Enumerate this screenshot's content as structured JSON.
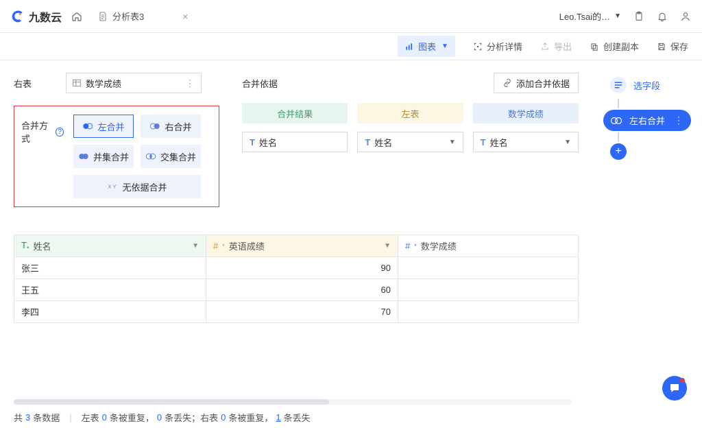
{
  "header": {
    "brand": "九数云",
    "tab_label": "分析表3",
    "user_label": "Leo.Tsai的…"
  },
  "toolbar": {
    "chart": "图表",
    "detail": "分析详情",
    "export": "导出",
    "duplicate": "创建副本",
    "save": "保存"
  },
  "config": {
    "right_table_label": "右表",
    "right_table_value": "数学成绩",
    "merge_mode_label": "合并方式",
    "merge_buttons": {
      "left": "左合并",
      "right": "右合并",
      "union": "并集合并",
      "intersect": "交集合并",
      "nobasis": "无依据合并"
    },
    "basis_label": "合并依据",
    "add_basis": "添加合并依据",
    "pills": {
      "result": "合并结果",
      "left": "左表",
      "math": "数学成绩"
    },
    "sel_name": "姓名"
  },
  "table": {
    "cols": {
      "name": "姓名",
      "eng": "英语成绩",
      "math": "数学成绩"
    },
    "rows": [
      {
        "name": "张三",
        "eng": "90",
        "math": ""
      },
      {
        "name": "王五",
        "eng": "60",
        "math": ""
      },
      {
        "name": "李四",
        "eng": "70",
        "math": ""
      }
    ],
    "type_t": "T",
    "type_n": "#"
  },
  "sidebar": {
    "select_fields": "选字段",
    "merge": "左右合并"
  },
  "status": {
    "total_prefix": "共",
    "total_n": "3",
    "total_suffix": "条数据",
    "left_label": "左表",
    "dup_n": "0",
    "dup_suffix": "条被重复，",
    "lost_n": "0",
    "lost_suffix": "条丢失；右表",
    "r_dup_n": "0",
    "r_dup_suffix": "条被重复，",
    "r_lost_n": "1",
    "r_lost_suffix": "条丢失"
  },
  "glyph": {
    "hash": "#"
  }
}
